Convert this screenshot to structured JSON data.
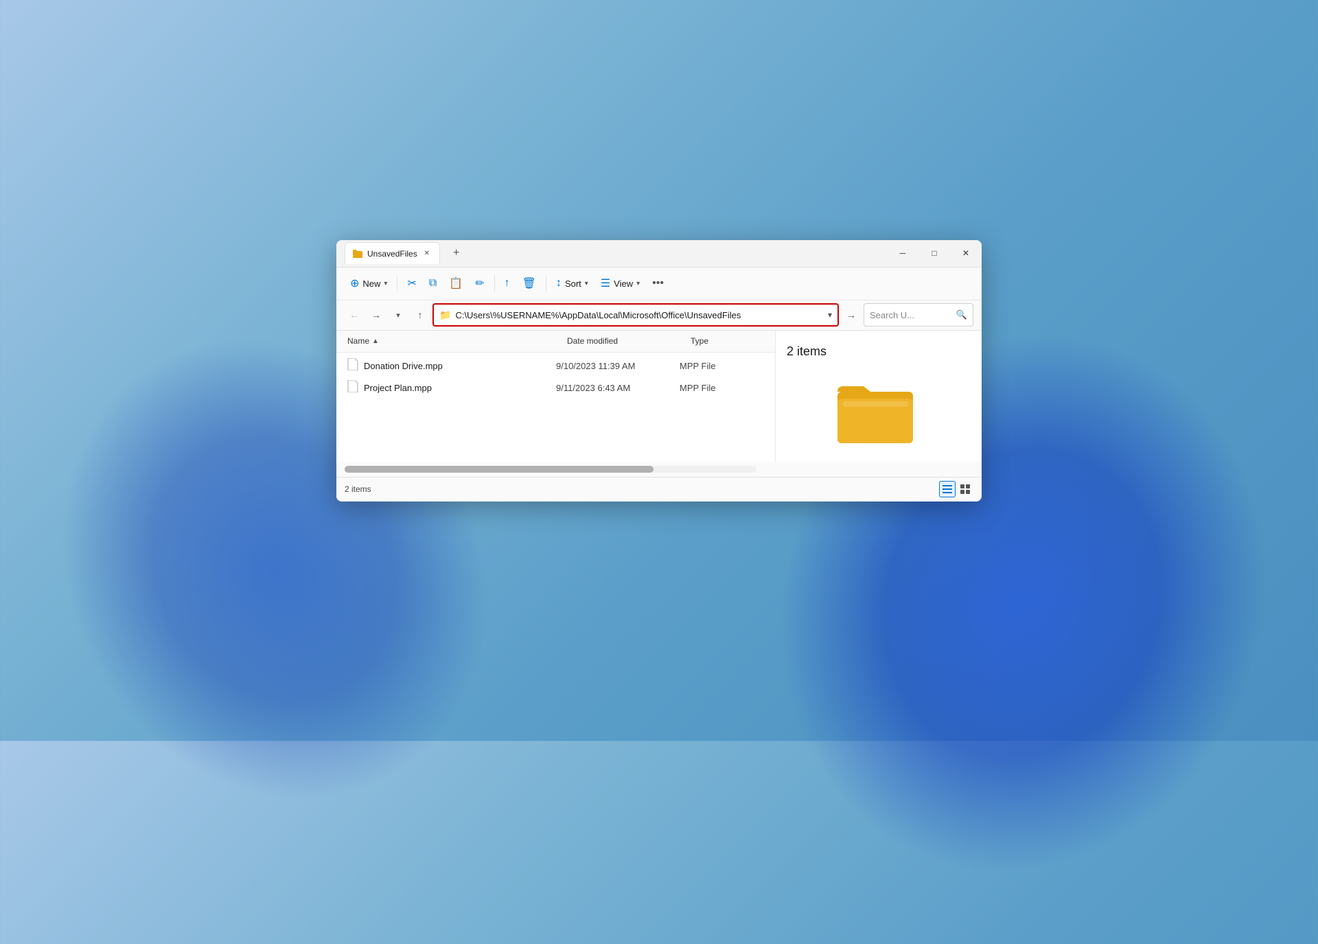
{
  "window": {
    "title": "UnsavedFiles",
    "tab_label": "UnsavedFiles",
    "close_label": "✕",
    "minimize_label": "─",
    "maximize_label": "□"
  },
  "toolbar": {
    "new_label": "New",
    "new_icon": "⊕",
    "cut_icon": "✂",
    "copy_icon": "⧉",
    "paste_icon": "📋",
    "rename_icon": "✏",
    "share_icon": "↑",
    "delete_icon": "🗑",
    "sort_label": "Sort",
    "sort_icon": "↕",
    "view_label": "View",
    "view_icon": "☰",
    "more_icon": "···"
  },
  "address_bar": {
    "path": "C:\\Users\\%USERNAME%\\AppData\\Local\\Microsoft\\Office\\UnsavedFiles",
    "folder_icon": "📁",
    "search_placeholder": "Search U..."
  },
  "columns": {
    "name": "Name",
    "date_modified": "Date modified",
    "type": "Type"
  },
  "files": [
    {
      "name": "Donation Drive.mpp",
      "date_modified": "9/10/2023 11:39 AM",
      "type": "MPP File"
    },
    {
      "name": "Project Plan.mpp",
      "date_modified": "9/11/2023 6:43 AM",
      "type": "MPP File"
    }
  ],
  "preview": {
    "count_label": "2 items"
  },
  "status_bar": {
    "items_label": "2 items"
  }
}
